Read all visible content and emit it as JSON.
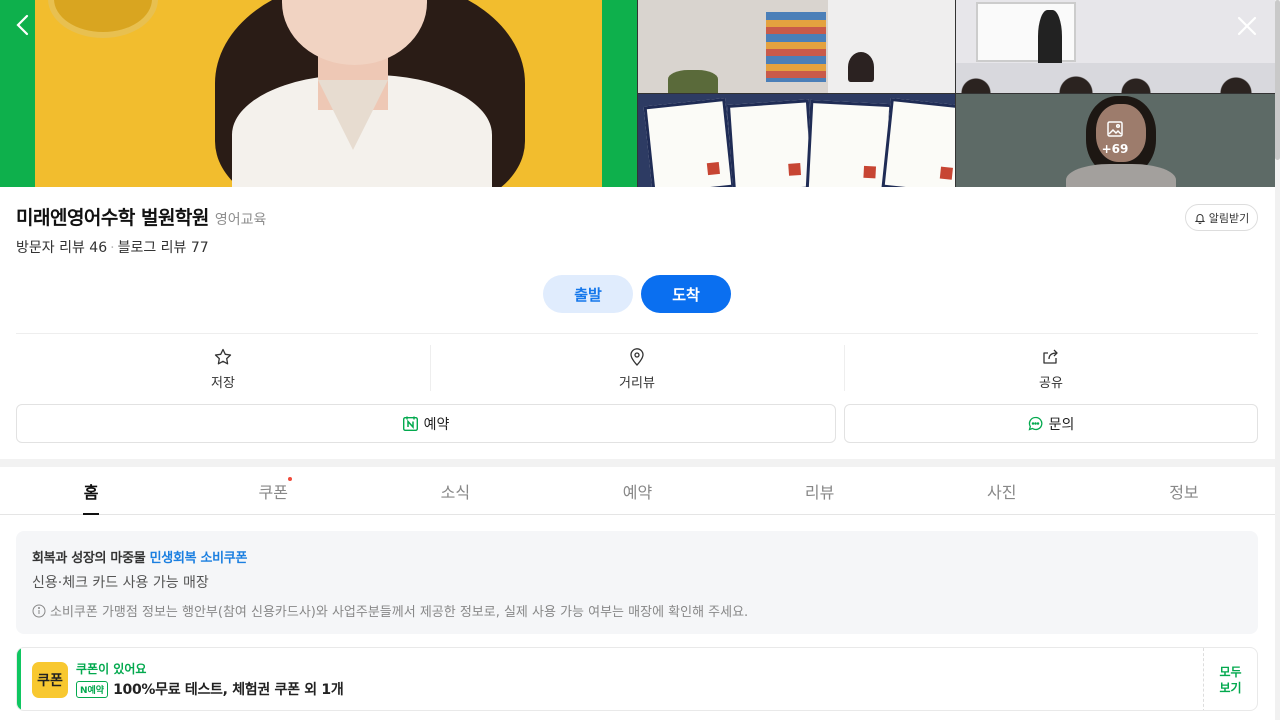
{
  "photos": {
    "more_count": "+69"
  },
  "place": {
    "name": "미래엔영어수학 벌원학원",
    "category": "영어교육",
    "visitor_review": "방문자 리뷰 46",
    "blog_review": "블로그 리뷰 77",
    "alarm_label": "알림받기"
  },
  "route": {
    "depart": "출발",
    "arrive": "도착"
  },
  "actions": {
    "save": "저장",
    "street_view": "거리뷰",
    "share": "공유"
  },
  "buttons": {
    "reserve": "예약",
    "inquiry": "문의"
  },
  "tabs": [
    "홈",
    "쿠폰",
    "소식",
    "예약",
    "리뷰",
    "사진",
    "정보"
  ],
  "notice": {
    "line1_prefix": "회복과 성장의 마중물 ",
    "line1_highlight": "민생회복 소비쿠폰",
    "line2": "신용·체크 카드 사용 가능 매장",
    "line3": "소비쿠폰 가맹점 정보는 행안부(참여 신용카드사)와 사업주분들께서 제공한 정보로, 실제 사용 가능 여부는 매장에 확인해 주세요."
  },
  "coupon": {
    "icon_label": "쿠폰",
    "title": "쿠폰이 있어요",
    "badge": "N예약",
    "text": "100%무료 테스트, 체험권 쿠폰 외 1개",
    "see_all": "모두\n보기"
  },
  "colors": {
    "accent": "#0a6ff0",
    "naver_green": "#03a94e",
    "coupon_yellow": "#f8c830"
  }
}
